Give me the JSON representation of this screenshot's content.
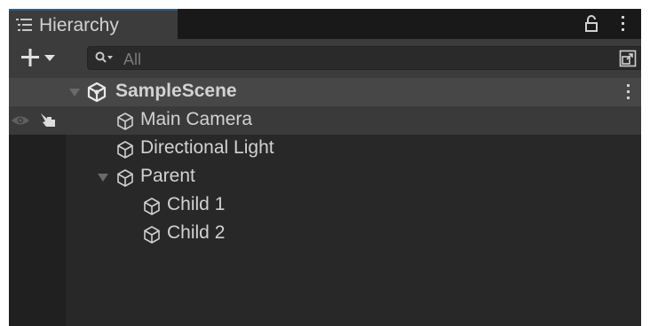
{
  "window": {
    "tab_title": "Hierarchy",
    "accent_color": "#2c5d87",
    "icons": {
      "tab": "list-icon",
      "lock": "lock-icon",
      "menu": "kebab-menu-icon"
    }
  },
  "toolbar": {
    "add_icon": "plus-dropdown-icon",
    "search": {
      "placeholder": "All",
      "value": "",
      "icon": "search-icon"
    },
    "popout_icon": "popout-icon"
  },
  "scene": {
    "name": "SampleScene",
    "icon": "unity-logo-icon",
    "expanded": true
  },
  "objects": [
    {
      "name": "Main Camera",
      "icon": "cube-icon",
      "hovered": true
    },
    {
      "name": "Directional Light",
      "icon": "cube-icon"
    },
    {
      "name": "Parent",
      "icon": "cube-icon",
      "expanded": true
    },
    {
      "name": "Child 1",
      "icon": "cube-icon",
      "parent": "Parent"
    },
    {
      "name": "Child 2",
      "icon": "cube-icon",
      "parent": "Parent"
    }
  ],
  "row_gutter": {
    "visibility_icon": "eye-icon",
    "pickability_icon": "pointing-hand-icon"
  }
}
